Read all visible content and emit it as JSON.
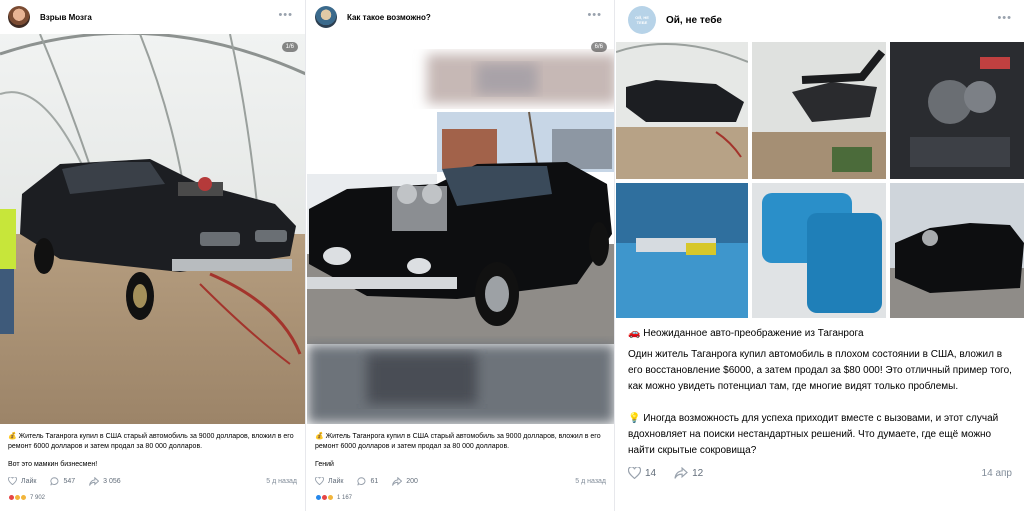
{
  "post1": {
    "group_name": "Взрыв Мозга",
    "photo_counter": "1/6",
    "text": "💰 Житель Таганрога купил в США старый автомобиль за 9000 долларов, вложил в его ремонт 6000 долларов и затем продал за 80 000 долларов.",
    "comment": "Вот это мамкин бизнесмен!",
    "like_label": "Лайк",
    "comments_count": "547",
    "shares_count": "3 056",
    "time": "5 д назад",
    "reactions_count": "7 902"
  },
  "post2": {
    "group_name": "Как такое возможно?",
    "photo_counter": "6/6",
    "text": "💰 Житель Таганрога купил в США старый автомобиль за 9000 долларов, вложил в его ремонт 6000 долларов и затем продал за 80 000 долларов.",
    "comment": "Гений",
    "like_label": "Лайк",
    "comments_count": "61",
    "shares_count": "200",
    "time": "5 д назад",
    "reactions_count": "1 167"
  },
  "post3": {
    "group_name": "Ой, не тебе",
    "avatar_text": "ОЙ, НЕ ТЕБЕ",
    "heading": "🚗 Неожиданное авто-преображение из Таганрога",
    "paragraph1": "Один житель Таганрога купил автомобиль в плохом состоянии в США, вложил в его восстановление $6000, а затем продал за $80 000! Это отличный пример того, как можно увидеть потенциал там, где многие видят только проблемы.",
    "paragraph2": "💡 Иногда возможность для успеха приходит вместе с вызовами, и этот случай вдохновляет на поиски нестандартных решений. Что думаете, где ещё можно найти скрытые сокровища?",
    "likes_count": "14",
    "shares_count": "12",
    "time": "14 апр"
  },
  "colors": {
    "accent": "#2688eb",
    "secondary_text": "#818c99",
    "icon": "#99a2ad",
    "avatar3_bg": "#b7d3e8"
  }
}
